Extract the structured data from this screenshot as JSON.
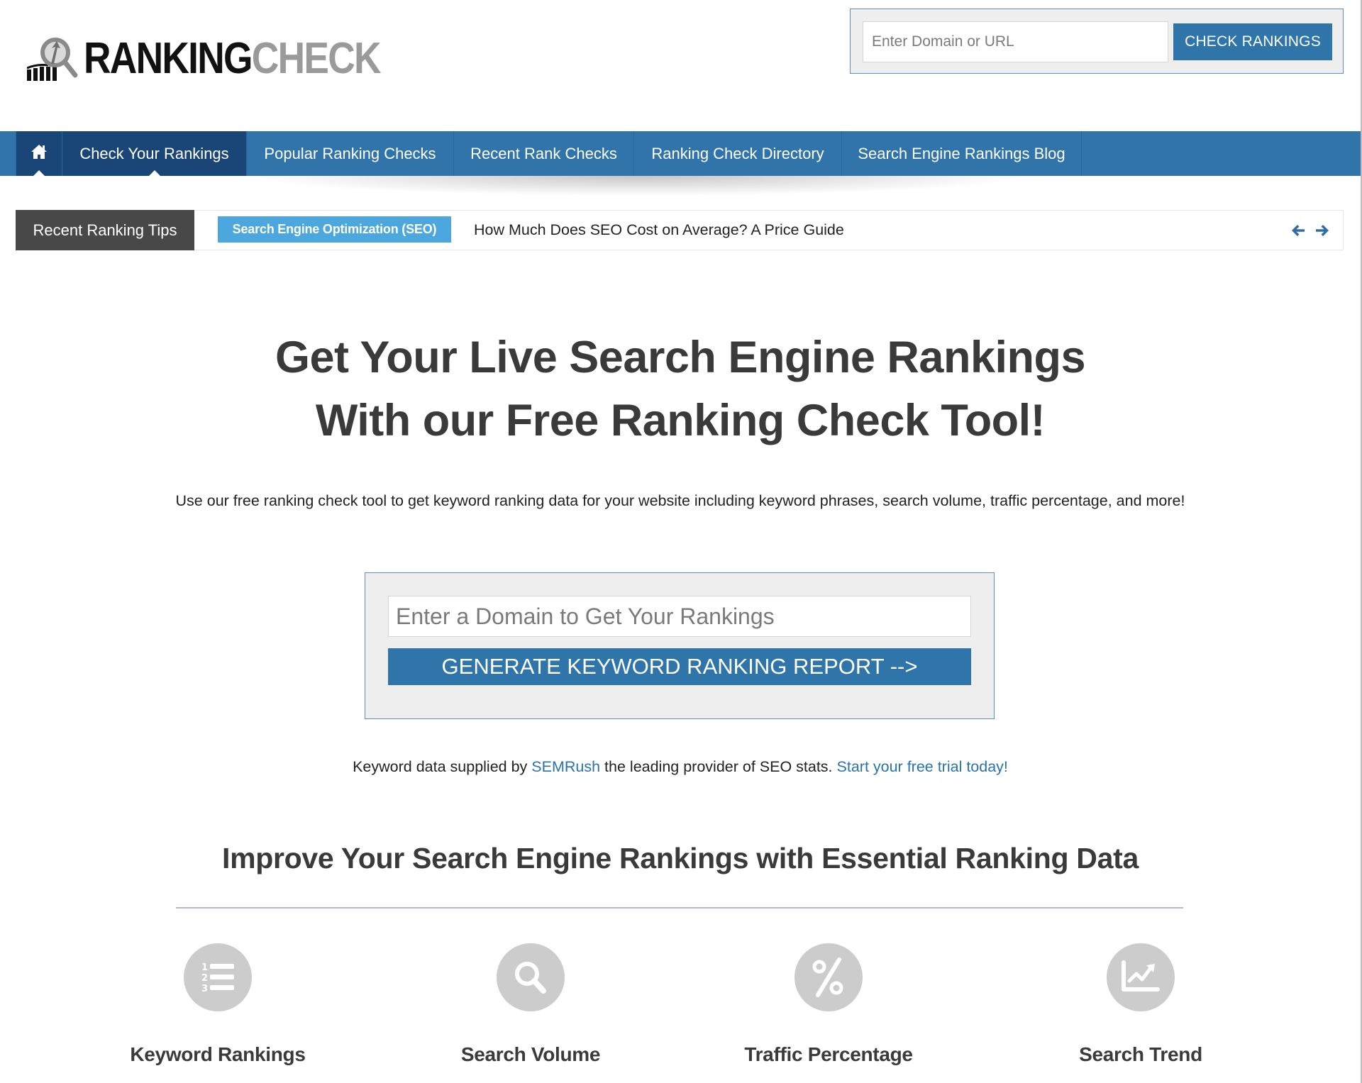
{
  "logo": {
    "part1": "RANKING",
    "part2": "CHECK"
  },
  "top_search": {
    "placeholder": "Enter Domain or URL",
    "value": "",
    "button_label": "CHECK RANKINGS"
  },
  "nav": {
    "home_icon": "home-icon",
    "items": [
      {
        "label": "Check Your Rankings",
        "active": true
      },
      {
        "label": "Popular Ranking Checks",
        "active": false
      },
      {
        "label": "Recent Rank Checks",
        "active": false
      },
      {
        "label": "Ranking Check Directory",
        "active": false
      },
      {
        "label": "Search Engine Rankings Blog",
        "active": false
      }
    ]
  },
  "ticker": {
    "label": "Recent Ranking Tips",
    "category": "Search Engine Optimization (SEO)",
    "headline": "How Much Does SEO Cost on Average? A Price Guide",
    "prev_icon": "arrow-left-icon",
    "next_icon": "arrow-right-icon"
  },
  "hero": {
    "title_line1": "Get Your Live Search Engine Rankings",
    "title_line2": "With our Free Ranking Check Tool!",
    "subtitle": "Use our free ranking check tool to get keyword ranking data for your website including keyword phrases, search volume, traffic percentage, and more!"
  },
  "report_form": {
    "placeholder": "Enter a Domain to Get Your Rankings",
    "value": "",
    "button_label": "GENERATE KEYWORD RANKING REPORT -->"
  },
  "supplied": {
    "prefix": "Keyword data supplied by ",
    "link1": "SEMRush",
    "middle": " the leading provider of SEO stats. ",
    "link2": "Start your free trial today!"
  },
  "features": {
    "title": "Improve Your Search Engine Rankings with Essential Ranking Data",
    "items": [
      {
        "label": "Keyword Rankings",
        "icon": "numbered-list-icon"
      },
      {
        "label": "Search Volume",
        "icon": "search-icon"
      },
      {
        "label": "Traffic Percentage",
        "icon": "percent-icon"
      },
      {
        "label": "Search Trend",
        "icon": "trend-chart-icon"
      }
    ]
  },
  "colors": {
    "brand_blue": "#3075aa",
    "nav_blue": "#3174a9",
    "nav_active": "#1a4577",
    "badge_blue": "#4ca7de",
    "ticker_label_bg": "#484848",
    "link_blue": "#2a73ad",
    "icon_circle": "#cccccc"
  }
}
